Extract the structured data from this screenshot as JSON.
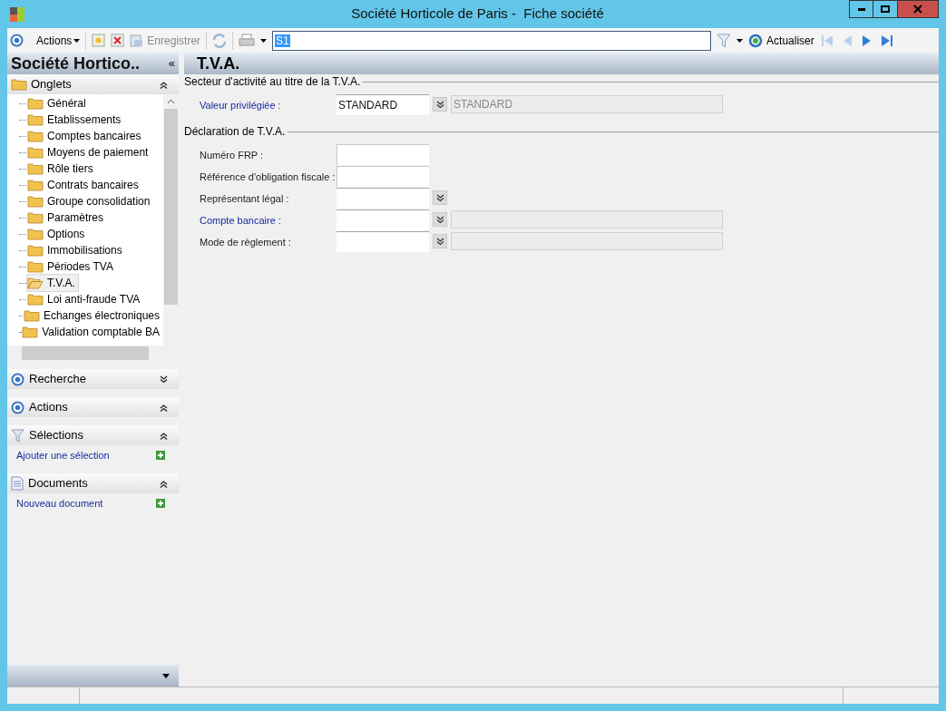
{
  "window": {
    "title": "Société Horticole de Paris -  Fiche société"
  },
  "toolbar": {
    "actions_label": "Actions",
    "save_label": "Enregistrer",
    "search_value": "S1",
    "refresh_label": "Actualiser"
  },
  "sidebar": {
    "title": "Société Hortico..",
    "collapse_glyph": "«",
    "tabs_header": {
      "label": "Onglets",
      "expanded": true
    },
    "items": [
      {
        "label": "Général",
        "selected": false
      },
      {
        "label": "Etablissements",
        "selected": false
      },
      {
        "label": "Comptes bancaires",
        "selected": false
      },
      {
        "label": "Moyens de paiement",
        "selected": false
      },
      {
        "label": "Rôle tiers",
        "selected": false
      },
      {
        "label": "Contrats bancaires",
        "selected": false
      },
      {
        "label": "Groupe consolidation",
        "selected": false
      },
      {
        "label": "Paramètres",
        "selected": false
      },
      {
        "label": "Options",
        "selected": false
      },
      {
        "label": "Immobilisations",
        "selected": false
      },
      {
        "label": "Périodes TVA",
        "selected": false
      },
      {
        "label": "T.V.A.",
        "selected": true
      },
      {
        "label": "Loi anti-fraude TVA",
        "selected": false
      },
      {
        "label": "Echanges électroniques",
        "selected": false
      },
      {
        "label": "Validation comptable BA",
        "selected": false
      }
    ],
    "panels": [
      {
        "kind": "target",
        "label": "Recherche",
        "expanded": false
      },
      {
        "kind": "target",
        "label": "Actions",
        "expanded": true
      },
      {
        "kind": "filter",
        "label": "Sélections",
        "expanded": true,
        "link": "Ajouter une sélection"
      },
      {
        "kind": "document",
        "label": "Documents",
        "expanded": true,
        "link": "Nouveau document"
      }
    ]
  },
  "content": {
    "title": "T.V.A.",
    "sections": [
      {
        "title": "Secteur d'activité au titre de la T.V.A.",
        "fields": [
          {
            "label": "Valeur privilégiée :",
            "link": true,
            "kind": "combo_described",
            "value": "STANDARD",
            "description": "STANDARD"
          }
        ]
      },
      {
        "title": "Déclaration de T.V.A.",
        "fields": [
          {
            "label": "Numéro FRP :",
            "link": false,
            "kind": "text"
          },
          {
            "label": "Référence d'obligation fiscale :",
            "link": false,
            "kind": "text"
          },
          {
            "label": "Représentant légal :",
            "link": false,
            "kind": "combo"
          },
          {
            "label": "Compte bancaire :",
            "link": true,
            "kind": "combo_described"
          },
          {
            "label": "Mode de règlement :",
            "link": false,
            "kind": "combo_described"
          }
        ]
      }
    ]
  }
}
